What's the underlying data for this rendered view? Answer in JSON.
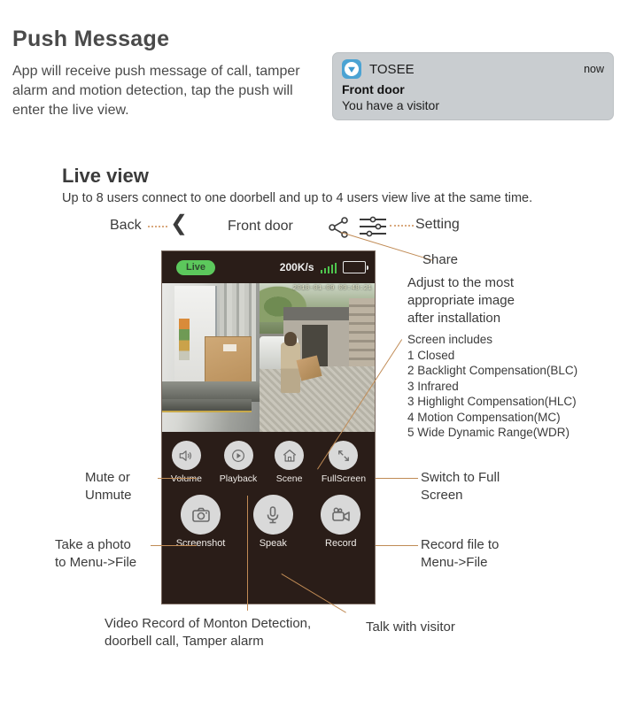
{
  "push_section": {
    "title": "Push Message",
    "description": "App will receive push message of call, tamper alarm and motion detection, tap the push will enter the live view."
  },
  "notification": {
    "app_name": "TOSEE",
    "time": "now",
    "title": "Front door",
    "body": "You have a visitor",
    "icon": "tosee-app-icon",
    "bg_color": "#c9cdd0",
    "icon_color": "#4ba3d3"
  },
  "live_view": {
    "title": "Live view",
    "subtitle": "Up to 8 users connect to one doorbell and up to 4 users view live at the same time.",
    "header": {
      "back_label": "Back",
      "back_icon": "chevron-left-icon",
      "screen_title": "Front door",
      "share_icon": "share-icon",
      "setting_icon": "settings-sliders-icon",
      "setting_label": "Setting",
      "share_label": "Share"
    }
  },
  "phone": {
    "status_bar": {
      "live_badge": "Live",
      "bitrate": "200K/s",
      "signal_icon": "signal-bars-icon",
      "battery_icon": "battery-icon",
      "accent_green": "#5cc85c"
    },
    "video": {
      "osd_timestamp": "2018-01-09 09:48:21"
    },
    "controls_row1": [
      {
        "label": "Volume",
        "icon": "speaker-volume-icon"
      },
      {
        "label": "Playback",
        "icon": "play-circle-icon"
      },
      {
        "label": "Scene",
        "icon": "home-icon"
      },
      {
        "label": "FullScreen",
        "icon": "fullscreen-arrows-icon"
      }
    ],
    "controls_row2": [
      {
        "label": "Screenshot",
        "icon": "camera-icon"
      },
      {
        "label": "Speak",
        "icon": "microphone-icon"
      },
      {
        "label": "Record",
        "icon": "video-camera-icon"
      }
    ]
  },
  "annotations": {
    "mute": "Mute or\nUnmute",
    "mute_line1": "Mute or",
    "mute_line2": "Unmute",
    "take_photo_line1": "Take a photo",
    "take_photo_line2": "to Menu->File",
    "fullscreen_line1": "Switch to Full",
    "fullscreen_line2": "Screen",
    "record_line1": "Record file to",
    "record_line2": "Menu->File",
    "adjust_line1": "Adjust to the most",
    "adjust_line2": "appropriate image",
    "adjust_line3": "after installation",
    "screen_includes_title": "Screen includes",
    "screen_includes": [
      "1 Closed",
      "2 Backlight Compensation(BLC)",
      "3  Infrared",
      "3 Highlight Compensation(HLC)",
      "4 Motion Compensation(MC)",
      "5 Wide Dynamic Range(WDR)"
    ],
    "video_record_line1": "Video Record of Monton Detection,",
    "video_record_line2": "doorbell call, Tamper alarm",
    "talk_with_visitor": "Talk with visitor"
  },
  "colors": {
    "leader_line": "#c08b55",
    "phone_body": "#2a1d18",
    "button_circle": "#d9d9d9"
  }
}
